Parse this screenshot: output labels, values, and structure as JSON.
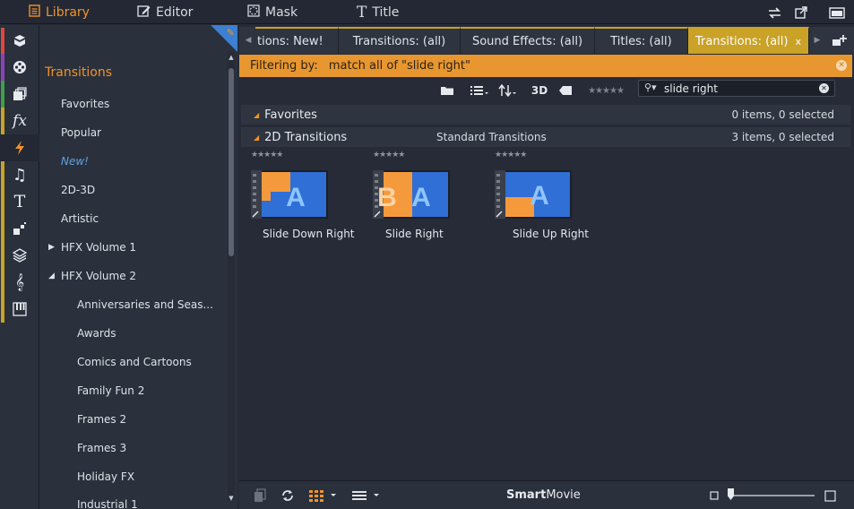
{
  "topbar": {
    "library": "Library",
    "editor": "Editor",
    "mask": "Mask",
    "title": "Title"
  },
  "sidebar": {
    "heading": "Transitions",
    "items": [
      {
        "label": "Favorites"
      },
      {
        "label": "Popular"
      },
      {
        "label": "New!"
      },
      {
        "label": "2D-3D"
      },
      {
        "label": "Artistic"
      },
      {
        "label": "HFX Volume 1"
      },
      {
        "label": "HFX Volume 2"
      },
      {
        "label": "Anniversaries and Seas..."
      },
      {
        "label": "Awards"
      },
      {
        "label": "Comics and Cartoons"
      },
      {
        "label": "Family Fun 2"
      },
      {
        "label": "Frames 2"
      },
      {
        "label": "Frames 3"
      },
      {
        "label": "Holiday FX"
      },
      {
        "label": "Industrial 1"
      }
    ]
  },
  "tabs": [
    {
      "label": "tions: New!"
    },
    {
      "label": "Transitions: (all)"
    },
    {
      "label": "Sound Effects: (all)"
    },
    {
      "label": "Titles: (all)"
    },
    {
      "label": "Transitions: (all)",
      "close": "x"
    }
  ],
  "filter": {
    "label": "Filtering by:",
    "text": "match all of \"slide right\""
  },
  "toolbar": {
    "three_d": "3D",
    "search_value": "slide right"
  },
  "sections": {
    "favorites": {
      "title": "Favorites",
      "count": "0 items, 0 selected"
    },
    "transitions2d": {
      "title": "2D Transitions",
      "subtitle": "Standard Transitions",
      "count": "3 items, 0 selected"
    }
  },
  "items": [
    {
      "label": "Slide Down Right"
    },
    {
      "label": "Slide Right"
    },
    {
      "label": "Slide Up Right"
    }
  ],
  "footer": {
    "smart": "Smart",
    "movie": "Movie"
  },
  "colors": {
    "accent": "#f0932b",
    "tab_active": "#c9a227",
    "thumb_blue": "#2f6fd6",
    "thumb_orange": "#f59a3c"
  }
}
